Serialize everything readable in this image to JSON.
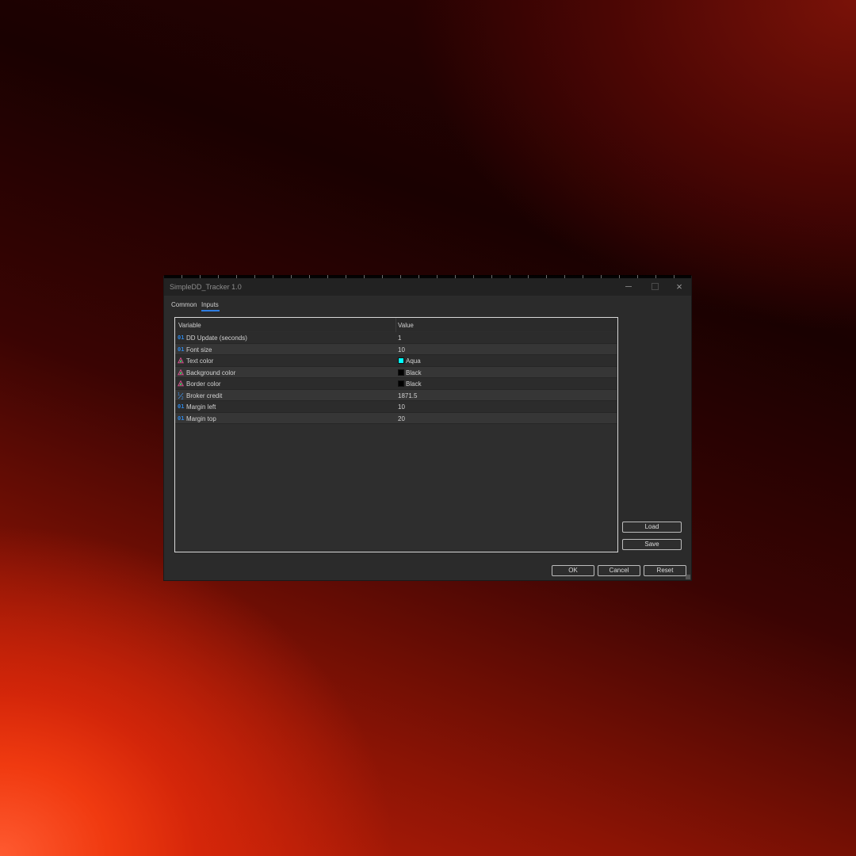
{
  "window": {
    "title": "SimpleDD_Tracker 1.0",
    "controls": {
      "minimize": "minimize-icon",
      "maximize": "maximize-icon",
      "close": "×"
    }
  },
  "tabs": [
    {
      "label": "Common",
      "active": false
    },
    {
      "label": "Inputs",
      "active": true
    }
  ],
  "grid": {
    "columns": {
      "variable": "Variable",
      "value": "Value"
    },
    "rows": [
      {
        "icon": "01",
        "icon_name": "integer-icon",
        "variable": "DD Update (seconds)",
        "value": "1"
      },
      {
        "icon": "01",
        "icon_name": "integer-icon",
        "variable": "Font size",
        "value": "10"
      },
      {
        "icon": "color",
        "icon_name": "color-palette-icon",
        "variable": "Text color",
        "value": "Aqua",
        "swatch": "#00ffff"
      },
      {
        "icon": "color",
        "icon_name": "color-palette-icon",
        "variable": "Background color",
        "value": "Black",
        "swatch": "#000000"
      },
      {
        "icon": "color",
        "icon_name": "color-palette-icon",
        "variable": "Border color",
        "value": "Black",
        "swatch": "#000000"
      },
      {
        "icon": "frac",
        "icon_name": "double-icon",
        "variable": "Broker credit",
        "value": "1871.5"
      },
      {
        "icon": "01",
        "icon_name": "integer-icon",
        "variable": "Margin left",
        "value": "10"
      },
      {
        "icon": "01",
        "icon_name": "integer-icon",
        "variable": "Margin top",
        "value": "20"
      }
    ]
  },
  "side_buttons": {
    "load": "Load",
    "save": "Save"
  },
  "footer_buttons": {
    "ok": "OK",
    "cancel": "Cancel",
    "reset": "Reset"
  },
  "colors": {
    "accent": "#2f7de1",
    "integer_icon": "#2f86e0",
    "color_icon": "#d24a8a"
  }
}
